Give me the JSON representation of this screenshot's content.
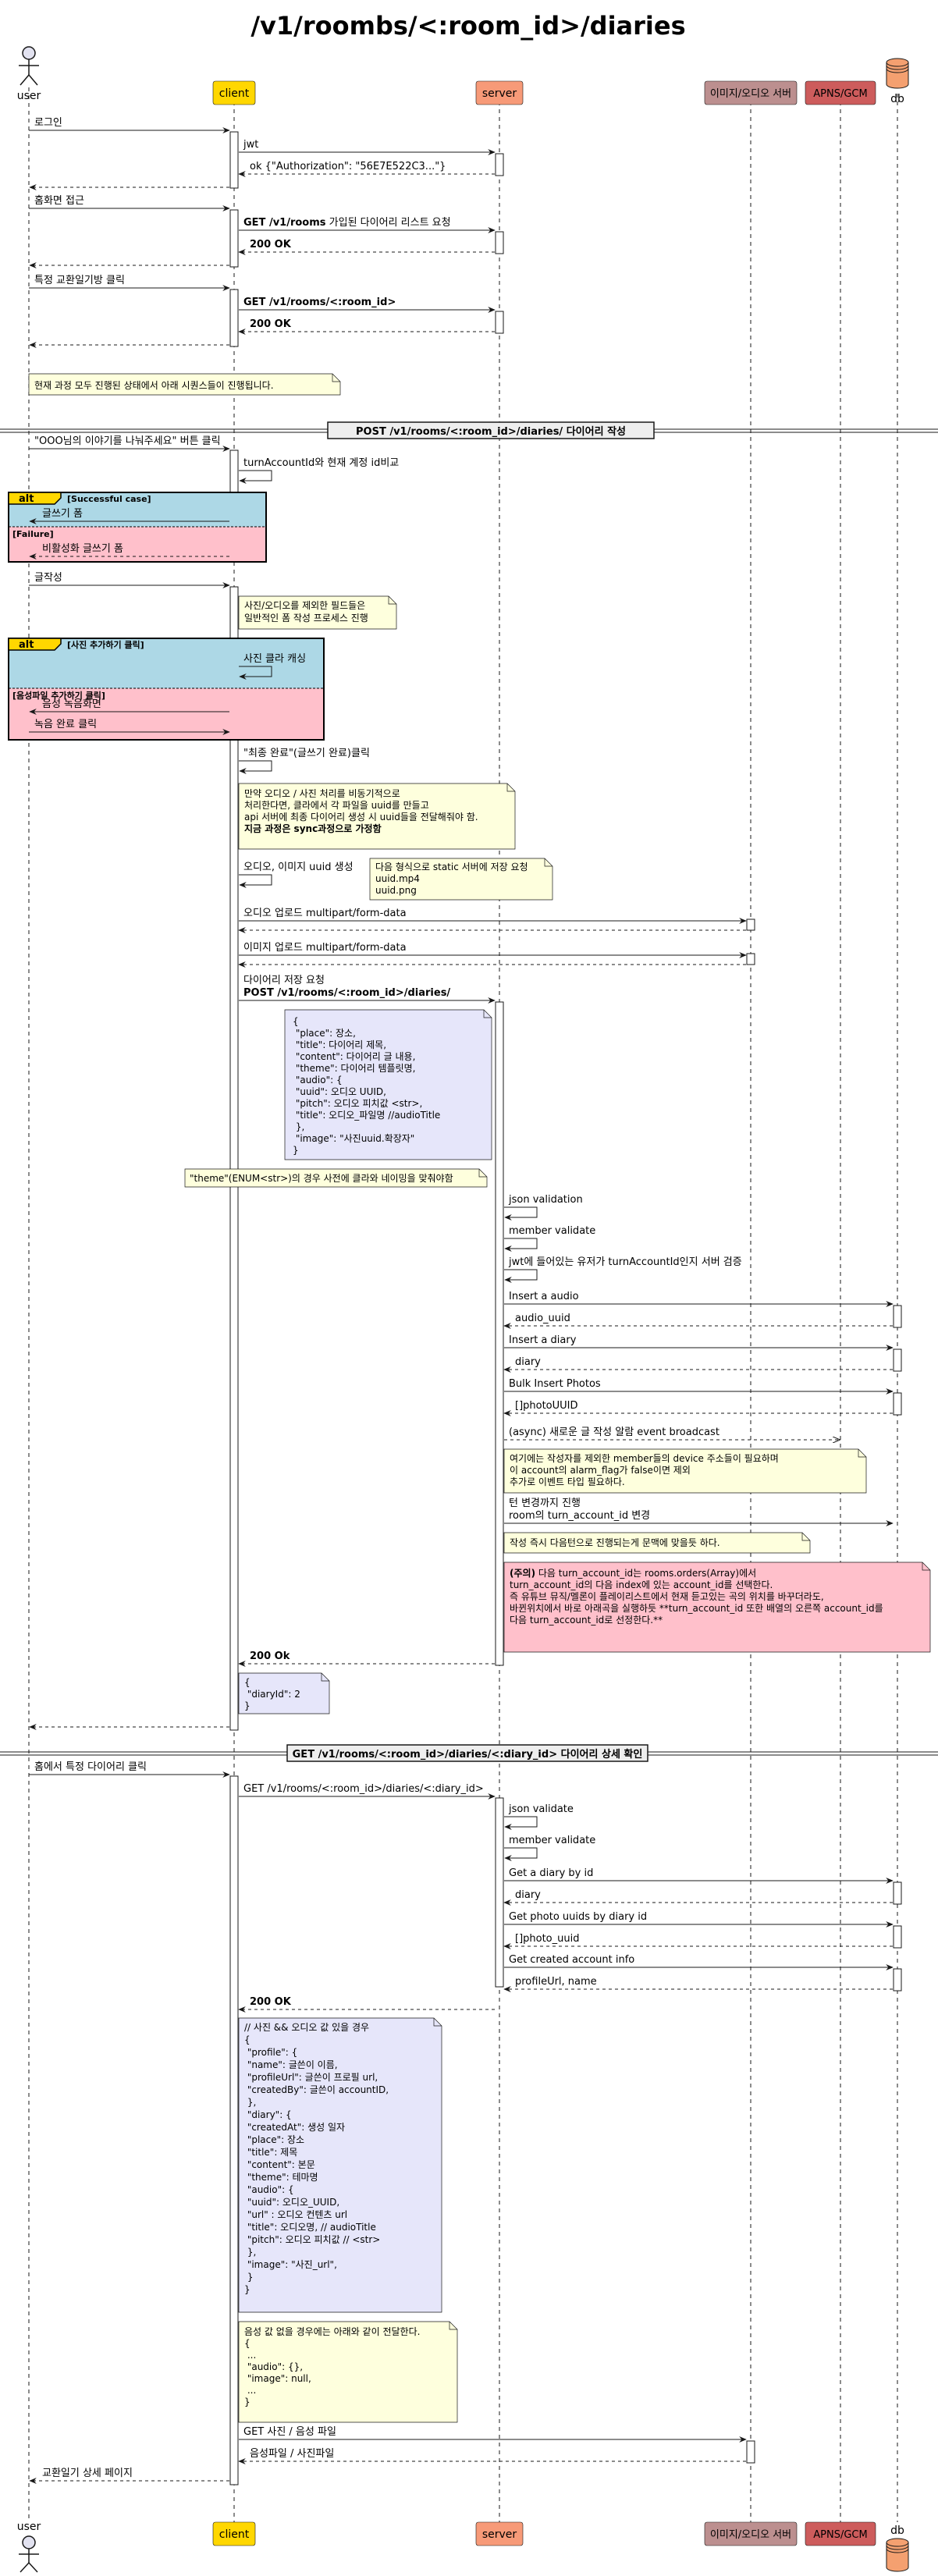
{
  "title": "/v1/roombs/<:room_id>/diaries",
  "participants": {
    "user": "user",
    "client": "client",
    "server": "server",
    "media": "이미지/오디오 서버",
    "apns": "APNS/GCM",
    "db": "db"
  },
  "colors": {
    "client": "#FFD700",
    "server": "#F79A78",
    "media": "#BC8F8F",
    "apns": "#CD5C5C",
    "db": "#F4A070",
    "alt_success": "#ADD8E6",
    "alt_failure": "#FFC0CB",
    "note_yellow": "#FEFFDD",
    "note_purple": "#E6E6FA",
    "note_pink": "#FFC0CB"
  },
  "sec0": {
    "m1": "로그인",
    "m2": "jwt",
    "m3": "ok {\"Authorization\": \"56E7E522C3...\"}",
    "m4": "홈화면 접근",
    "m5_bold": "GET /v1/rooms",
    "m5_rest": " 가입된 다이어리 리스트 요청",
    "m6": "200 OK",
    "m7": "특정 교환일기방 클릭",
    "m8": "GET /v1/rooms/<:room_id>",
    "m9": "200 OK",
    "note": "현재 과정 모두 진행된 상태에서 아래 시퀀스들이 진행됩니다."
  },
  "sec1": {
    "divider": "POST /v1/rooms/<:room_id>/diaries/ 다이어리 작성",
    "m1": "\"OOO님의 이야기를 나눠주세요\" 버튼 클릭",
    "m2": "turnAccountId와 현재 계정 id비교",
    "alt1": {
      "tag": "alt",
      "cond": "[Successful case]",
      "m1": "글쓰기 폼",
      "else": "[Failure]",
      "m2": "비활성화 글쓰기 폼"
    },
    "m3": "글작성",
    "note1": [
      "사진/오디오를 제외한 필드들은",
      "일반적인 폼 작성 프로세스 진행"
    ],
    "alt2": {
      "tag": "alt",
      "cond": "[사진 추가하기 클릭]",
      "m1": "사진 클라 캐싱",
      "else": "[음성파일 추가하기 클릭]",
      "m2": "음성 녹음화면",
      "m3": "녹음 완료 클릭"
    },
    "m4": "\"최종 완료\"(글쓰기 완료)클릭",
    "note2": [
      "만약 오디오 / 사진 처리를 비동기적으로",
      "처리한다면, 클라에서 각 파일을 uuid를 만들고",
      "api 서버에 최종 다이어리 생성 시 uuid들을 전달해줘야 함.",
      "",
      "지금 과정은 sync과정으로 가정함"
    ],
    "m5": "오디오, 이미지 uuid 생성",
    "note3": [
      "다음 형식으로 static 서버에 저장 요청",
      "uuid.mp4",
      "uuid.png"
    ],
    "m6": "오디오 업로드 multipart/form-data",
    "m7": "이미지 업로드 multipart/form-data",
    "m8a": "다이어리 저장 요청",
    "m8b": "POST /v1/rooms/<:room_id>/diaries/",
    "note4": [
      "{",
      "    \"place\": 장소,",
      "    \"title\": 다이어리 제목,",
      "    \"content\": 다이어리 글 내용,",
      "    \"theme\": 다이어리 템플릿명,",
      "    \"audio\": {",
      "        \"uuid\": 오디오 UUID,",
      "        \"pitch\": 오디오 피치값 <str>,",
      "        \"title\": 오디오_파일명 //audioTitle",
      "    },",
      "    \"image\": \"사진uuid.확장자\"",
      "}"
    ],
    "note5": "\"theme\"(ENUM<str>)의 경우 사전에 클라와 네이밍을 맞춰야함",
    "s1": "json validation",
    "s2": "member validate",
    "s3": "jwt에 들어있는 유저가 turnAccountId인지 서버 검증",
    "s4": "Insert a audio",
    "s5": "audio_uuid",
    "s6": "Insert a diary",
    "s7": "diary",
    "s8": "Bulk Insert Photos",
    "s9": "[]photoUUID",
    "s10": "(async) 새로운 글 작성 알람 event broadcast",
    "note6": [
      "여기에는 작성자를 제외한 member들의 device 주소들이 필요하며",
      "이 account의 alarm_flag가 false이면 제외",
      "추가로 이벤트 타입 필요하다."
    ],
    "s11a": "턴 변경까지 진행",
    "s11b": "room의 turn_account_id 변경",
    "note7": "작성 즉시 다음턴으로 진행되는게 문맥에 맞을듯 하다.",
    "note8_bold": "(주의)",
    "note8": [
      " 다음 turn_account_id는 rooms.orders(Array)에서",
      "turn_account_id의 다음 index에 있는 account_id를 선택한다.",
      "",
      "즉 유튜브 뮤직/멜론이 플레이리스트에서 현재 듣고있는 곡의 위치를 바꾸더라도,",
      "바뀐위치에서 바로 아래곡을 실행하듯 **turn_account_id 또한 배열의 오른쪽 account_id를",
      "다음 turn_account_id로 선정한다.**"
    ],
    "r1": "200 Ok",
    "note9": [
      "{",
      "    \"diaryId\": 2",
      "}"
    ]
  },
  "sec2": {
    "divider": "GET /v1/rooms/<:room_id>/diaries/<:diary_id> 다이어리 상세 확인",
    "m1": "홈에서 특정 다이어리 클릭",
    "m2": "GET /v1/rooms/<:room_id>/diaries/<:diary_id>",
    "s1": "json validate",
    "s2": "member validate",
    "s3": "Get a diary by id",
    "s4": "diary",
    "s5": "Get photo uuids by diary id",
    "s6": "[]photo_uuid",
    "s7": "Get created account info",
    "s8": "profileUrl, name",
    "r1": "200 OK",
    "note1": [
      "// 사진 && 오디오 값 있을 경우",
      "{",
      "    \"profile\": {",
      "        \"name\": 글쓴이 이름,",
      "        \"profileUrl\": 글쓴이 프로필 url,",
      "        \"createdBy\": 글쓴이 accountID,",
      "    },",
      "    \"diary\": {",
      "        \"createdAt\": 생성 일자",
      "        \"place\":  장소",
      "        \"title\":  제목",
      "        \"content\": 본문",
      "        \"theme\":  테마명",
      "        \"audio\": {",
      "            \"uuid\": 오디오_UUID,",
      "            \"url\" : 오디오 컨텐츠 url",
      "            \"title\": 오디오명, // audioTitle",
      "            \"pitch\": 오디오 피치값 // <str>",
      "        },",
      "        \"image\": \"사진_url\",",
      "    }",
      "}"
    ],
    "note2": [
      "음성 값 없을 경우에는 아래와 같이 전달한다.",
      "",
      "{",
      "    ...",
      "    \"audio\": {},",
      "    \"image\": null,",
      "    ...",
      "}"
    ],
    "m3": "GET 사진 / 음성 파일",
    "m4": "음성파일 / 사진파일",
    "m5": "교환일기 상세 페이지"
  }
}
